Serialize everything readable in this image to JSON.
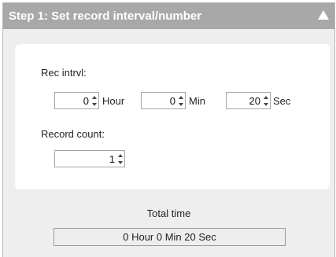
{
  "header": {
    "title": "Step 1: Set record interval/number"
  },
  "interval": {
    "label": "Rec intrvl:",
    "hour": {
      "value": "0",
      "unit": "Hour"
    },
    "min": {
      "value": "0",
      "unit": "Min"
    },
    "sec": {
      "value": "20",
      "unit": "Sec"
    }
  },
  "record_count": {
    "label": "Record count:",
    "value": "1"
  },
  "total": {
    "title": "Total time",
    "value": "0 Hour 0 Min 20 Sec"
  },
  "colors": {
    "header_bg": "#a8a8a8",
    "panel_bg": "#eeeeee",
    "card_bg": "#ffffff"
  },
  "icons": {
    "collapse": "triangle-up-icon"
  }
}
